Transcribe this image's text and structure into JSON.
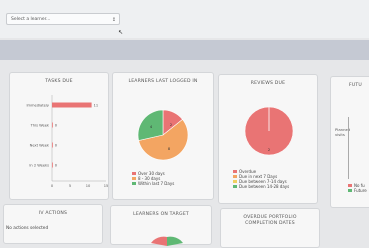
{
  "header": {
    "learner_select_placeholder": "Select a learner..."
  },
  "panels": {
    "tasks_due": {
      "title": "TASKS DUE",
      "categories": [
        "Immediately",
        "This Week",
        "Next Week",
        "In 2 Weeks"
      ],
      "values": [
        11,
        0,
        0,
        0
      ],
      "ticks": [
        "0",
        "5",
        "10",
        "15"
      ]
    },
    "learners_last_logged_in": {
      "title": "LEARNERS LAST LOGGED IN",
      "slice_labels": [
        "4",
        "2",
        "8"
      ],
      "legend": [
        {
          "label": "Over 30 days",
          "color": "#e97474"
        },
        {
          "label": "8 - 30 days",
          "color": "#f3a562"
        },
        {
          "label": "Within last 7 Days",
          "color": "#5fb874"
        }
      ]
    },
    "reviews_due": {
      "title": "REVIEWS DUE",
      "slice_labels": [
        "2"
      ],
      "legend": [
        {
          "label": "Overdue",
          "color": "#e97474"
        },
        {
          "label": "Due in next 7 Days",
          "color": "#f3a562"
        },
        {
          "label": "Due between 7-14 days",
          "color": "#f0d060"
        },
        {
          "label": "Due between 14-28 days",
          "color": "#5fb874"
        }
      ]
    },
    "future": {
      "title": "FUTU",
      "axis_label_line1": "Planned",
      "axis_label_line2": "visits",
      "legend": [
        {
          "label": "No fu",
          "color": "#e97474"
        },
        {
          "label": "Future",
          "color": "#5fb874"
        }
      ]
    },
    "iv_actions": {
      "title": "IV ACTIONS",
      "message": "No actions selected"
    },
    "learners_on_target": {
      "title": "LEARNERS ON TARGET"
    },
    "overdue_portfolio": {
      "title_line1": "OVERDUE PORTFOLIO",
      "title_line2": "COMPLETION DATES"
    }
  },
  "chart_data": [
    {
      "type": "bar",
      "title": "TASKS DUE",
      "categories": [
        "Immediately",
        "This Week",
        "Next Week",
        "In 2 Weeks"
      ],
      "values": [
        11,
        0,
        0,
        0
      ],
      "xlim": [
        0,
        15
      ]
    },
    {
      "type": "pie",
      "title": "LEARNERS LAST LOGGED IN",
      "labels": [
        "Over 30 days",
        "8 - 30 days",
        "Within last 7 Days"
      ],
      "values": [
        2,
        8,
        4
      ]
    },
    {
      "type": "pie",
      "title": "REVIEWS DUE",
      "labels": [
        "Overdue",
        "Due in next 7 Days",
        "Due between 7-14 days",
        "Due between 14-28 days"
      ],
      "values": [
        2,
        0,
        0,
        0
      ]
    }
  ]
}
